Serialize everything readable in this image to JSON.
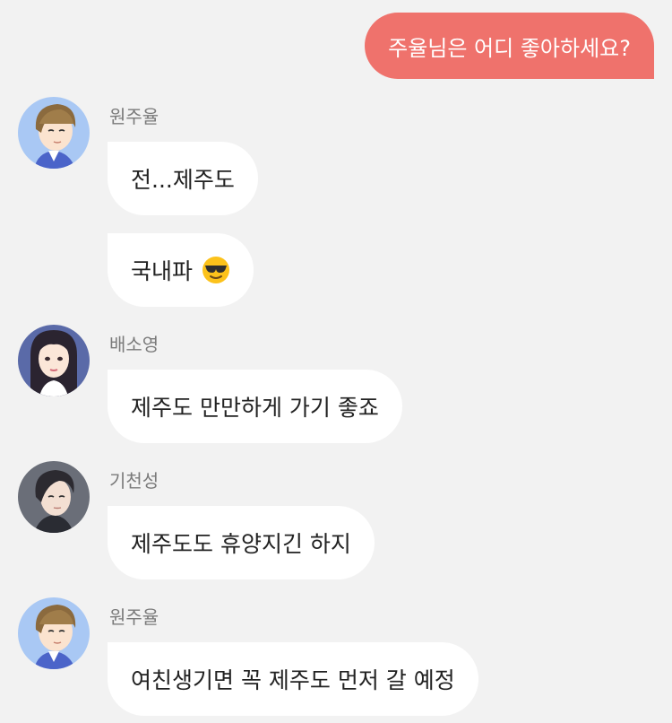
{
  "sent": {
    "text": "주율님은 어디 좋아하세요?"
  },
  "messages": [
    {
      "sender": "원주율",
      "bubbles": [
        "전...제주도",
        "국내파"
      ]
    },
    {
      "sender": "배소영",
      "bubbles": [
        "제주도 만만하게 가기 좋죠"
      ]
    },
    {
      "sender": "기천성",
      "bubbles": [
        "제주도도 휴양지긴 하지"
      ]
    },
    {
      "sender": "원주율",
      "bubbles": [
        "여친생기면 꼭 제주도 먼저 갈 예정"
      ]
    }
  ],
  "icons": {
    "emoji": "sunglasses-emoji-icon"
  },
  "colors": {
    "background": "#f2f2f2",
    "sent_bubble": "#ef726c",
    "received_bubble": "#ffffff",
    "sender_name": "#7a7a7a"
  }
}
